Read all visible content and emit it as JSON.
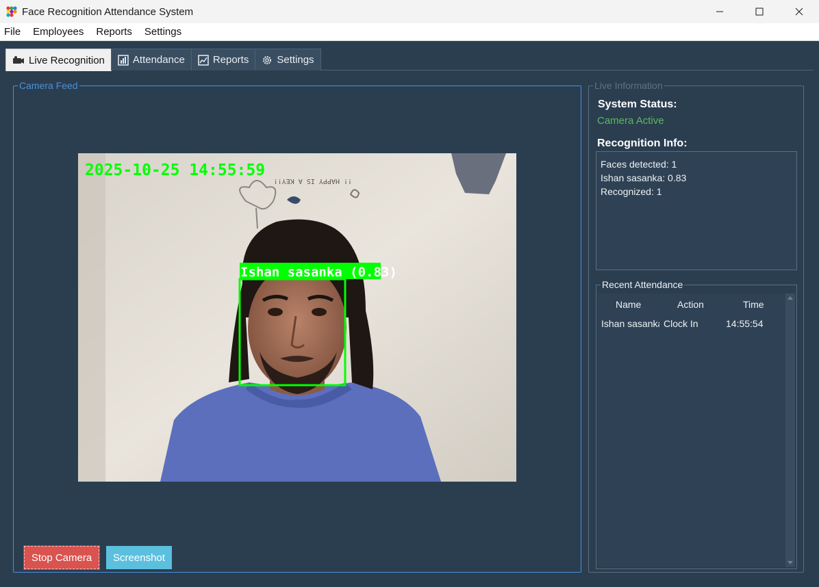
{
  "window": {
    "title": "Face Recognition Attendance System"
  },
  "menu": [
    "File",
    "Employees",
    "Reports",
    "Settings"
  ],
  "tabs": [
    {
      "label": "Live Recognition",
      "icon": "camera-icon",
      "active": true
    },
    {
      "label": "Attendance",
      "icon": "bar-chart-icon",
      "active": false
    },
    {
      "label": "Reports",
      "icon": "line-chart-icon",
      "active": false
    },
    {
      "label": "Settings",
      "icon": "gear-icon",
      "active": false
    }
  ],
  "camera": {
    "group_title": "Camera Feed",
    "timestamp": "2025-10-25 14:55:59",
    "face_label": "Ishan sasanka (0.83)",
    "stop_button": "Stop Camera",
    "screenshot_button": "Screenshot"
  },
  "info": {
    "group_title": "Live Information",
    "system_status_label": "System Status:",
    "system_status_value": "Camera Active",
    "recognition_label": "Recognition Info:",
    "recognition_lines": [
      "Faces detected: 1",
      "Ishan sasanka: 0.83",
      "Recognized: 1"
    ]
  },
  "attendance": {
    "group_title": "Recent Attendance",
    "headers": [
      "Name",
      "Action",
      "Time"
    ],
    "rows": [
      {
        "name": "Ishan sasanka",
        "action": "Clock In",
        "time": "14:55:54"
      }
    ]
  },
  "colors": {
    "background": "#2b3e50",
    "accent": "#4a90d9",
    "stop": "#d9534f",
    "screenshot": "#5bc0de",
    "status_ok": "#5cb85c",
    "overlay_green": "#00ff00"
  }
}
